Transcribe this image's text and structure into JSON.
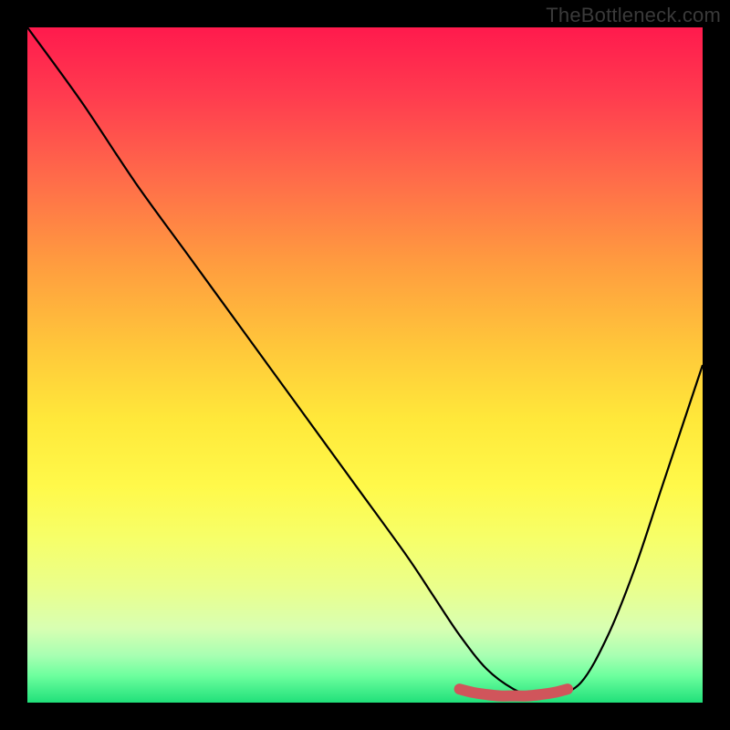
{
  "watermark": "TheBottleneck.com",
  "colors": {
    "curve": "#000000",
    "marker": "#d0555b",
    "frame": "#000000"
  },
  "chart_data": {
    "type": "line",
    "title": "",
    "xlabel": "",
    "ylabel": "",
    "xlim": [
      0,
      100
    ],
    "ylim": [
      0,
      100
    ],
    "grid": false,
    "legend": false,
    "series": [
      {
        "name": "bottleneck-curve",
        "x": [
          0,
          8,
          16,
          24,
          32,
          40,
          48,
          56,
          60,
          64,
          68,
          72,
          75,
          78,
          82,
          86,
          90,
          94,
          100
        ],
        "y": [
          100,
          89,
          77,
          66,
          55,
          44,
          33,
          22,
          16,
          10,
          5,
          2,
          1,
          1,
          3,
          10,
          20,
          32,
          50
        ]
      },
      {
        "name": "optimal-range-marker",
        "x": [
          64,
          66,
          68,
          70,
          72,
          74,
          76,
          78,
          80
        ],
        "y": [
          2,
          1.5,
          1.2,
          1,
          1,
          1,
          1.2,
          1.5,
          2
        ]
      }
    ],
    "annotations": []
  }
}
